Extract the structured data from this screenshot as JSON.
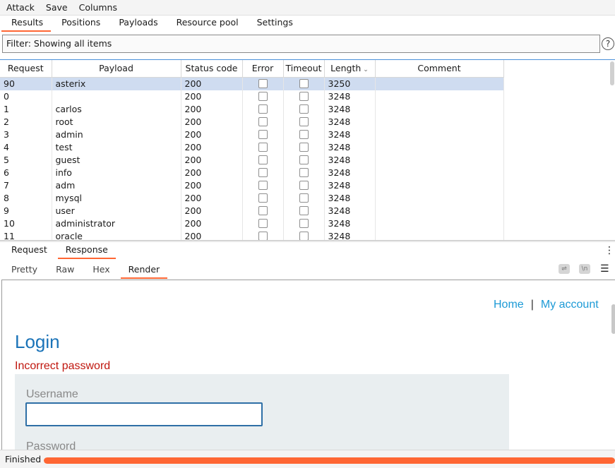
{
  "menubar": {
    "items": [
      "Attack",
      "Save",
      "Columns"
    ]
  },
  "top_tabs": [
    {
      "label": "Results",
      "active": true
    },
    {
      "label": "Positions",
      "active": false
    },
    {
      "label": "Payloads",
      "active": false
    },
    {
      "label": "Resource pool",
      "active": false
    },
    {
      "label": "Settings",
      "active": false
    }
  ],
  "filter": {
    "text": "Filter: Showing all items"
  },
  "help_glyph": "?",
  "results_table": {
    "columns": [
      "Request",
      "Payload",
      "Status code",
      "Error",
      "Timeout",
      "Length",
      "Comment"
    ],
    "sorted_column": "Length",
    "rows": [
      {
        "request": "90",
        "payload": "asterix",
        "status": "200",
        "length": "3250",
        "selected": true
      },
      {
        "request": "0",
        "payload": "",
        "status": "200",
        "length": "3248",
        "selected": false
      },
      {
        "request": "1",
        "payload": "carlos",
        "status": "200",
        "length": "3248",
        "selected": false
      },
      {
        "request": "2",
        "payload": "root",
        "status": "200",
        "length": "3248",
        "selected": false
      },
      {
        "request": "3",
        "payload": "admin",
        "status": "200",
        "length": "3248",
        "selected": false
      },
      {
        "request": "4",
        "payload": "test",
        "status": "200",
        "length": "3248",
        "selected": false
      },
      {
        "request": "5",
        "payload": "guest",
        "status": "200",
        "length": "3248",
        "selected": false
      },
      {
        "request": "6",
        "payload": "info",
        "status": "200",
        "length": "3248",
        "selected": false
      },
      {
        "request": "7",
        "payload": "adm",
        "status": "200",
        "length": "3248",
        "selected": false
      },
      {
        "request": "8",
        "payload": "mysql",
        "status": "200",
        "length": "3248",
        "selected": false
      },
      {
        "request": "9",
        "payload": "user",
        "status": "200",
        "length": "3248",
        "selected": false
      },
      {
        "request": "10",
        "payload": "administrator",
        "status": "200",
        "length": "3248",
        "selected": false
      },
      {
        "request": "11",
        "payload": "oracle",
        "status": "200",
        "length": "3248",
        "selected": false
      }
    ]
  },
  "message_tabs": [
    {
      "label": "Request",
      "active": false
    },
    {
      "label": "Response",
      "active": true
    }
  ],
  "view_tabs": [
    {
      "label": "Pretty",
      "active": false
    },
    {
      "label": "Raw",
      "active": false
    },
    {
      "label": "Hex",
      "active": false
    },
    {
      "label": "Render",
      "active": true
    }
  ],
  "toolbar_glyphs": {
    "wrap": "⇌",
    "newline": "\\n",
    "menu": "☰",
    "kebab": "⋮"
  },
  "rendered_page": {
    "nav": {
      "home": "Home",
      "separator": "|",
      "account": "My account"
    },
    "title": "Login",
    "error": "Incorrect password",
    "username_label": "Username",
    "password_label": "Password"
  },
  "status": {
    "text": "Finished",
    "progress_fraction": 1.0
  },
  "colors": {
    "accent": "#ff6633",
    "selection": "#cfdcf0",
    "link": "#1c9ad6",
    "title": "#1a73b8",
    "error": "#c0170f"
  }
}
